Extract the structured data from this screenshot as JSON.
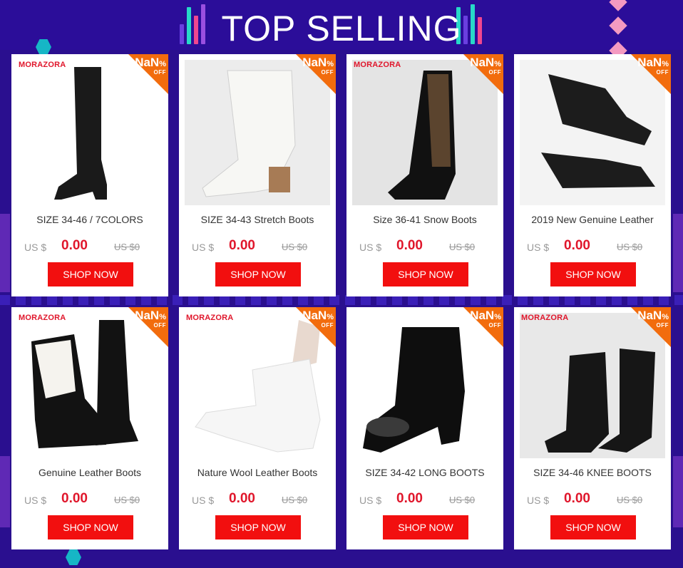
{
  "header": {
    "title": "TOP SELLING"
  },
  "ribbon": {
    "value": "NaN",
    "percent": "%",
    "off": "OFF"
  },
  "currency_label": "US $",
  "button_label": "SHOP NOW",
  "colors": {
    "background": "#2a0f8f",
    "price": "#e0162b",
    "button": "#f20f0f",
    "ribbon": "#f26c0d",
    "accent_pink": "#f49ac1",
    "accent_teal": "#16b6c6"
  },
  "products": [
    {
      "brand": "MORAZORA",
      "name": "SIZE 34-46 / 7COLORS",
      "price": "0.00",
      "old_price": "US $0",
      "image_icon": "black-over-knee-boot-icon"
    },
    {
      "brand": "",
      "name": "SIZE 34-43 Stretch Boots",
      "price": "0.00",
      "old_price": "US $0",
      "image_icon": "white-western-boot-icon"
    },
    {
      "brand": "MORAZORA",
      "name": "Size 36-41 Snow Boots",
      "price": "0.00",
      "old_price": "US $0",
      "image_icon": "embroidered-knee-boot-icon"
    },
    {
      "brand": "",
      "name": "2019 New Genuine Leather",
      "price": "0.00",
      "old_price": "US $0",
      "image_icon": "black-ankle-boot-icon"
    },
    {
      "brand": "MORAZORA",
      "name": "Genuine Leather Boots",
      "price": "0.00",
      "old_price": "US $0",
      "image_icon": "fur-lined-knee-boot-icon"
    },
    {
      "brand": "MORAZORA",
      "name": "Nature Wool Leather Boots",
      "price": "0.00",
      "old_price": "US $0",
      "image_icon": "white-puffer-boot-icon"
    },
    {
      "brand": "",
      "name": "SIZE 34-42 LONG BOOTS",
      "price": "0.00",
      "old_price": "US $0",
      "image_icon": "patent-lace-up-boot-icon"
    },
    {
      "brand": "MORAZORA",
      "name": "SIZE 34-46 KNEE BOOTS",
      "price": "0.00",
      "old_price": "US $0",
      "image_icon": "quilted-knee-boot-icon"
    }
  ]
}
